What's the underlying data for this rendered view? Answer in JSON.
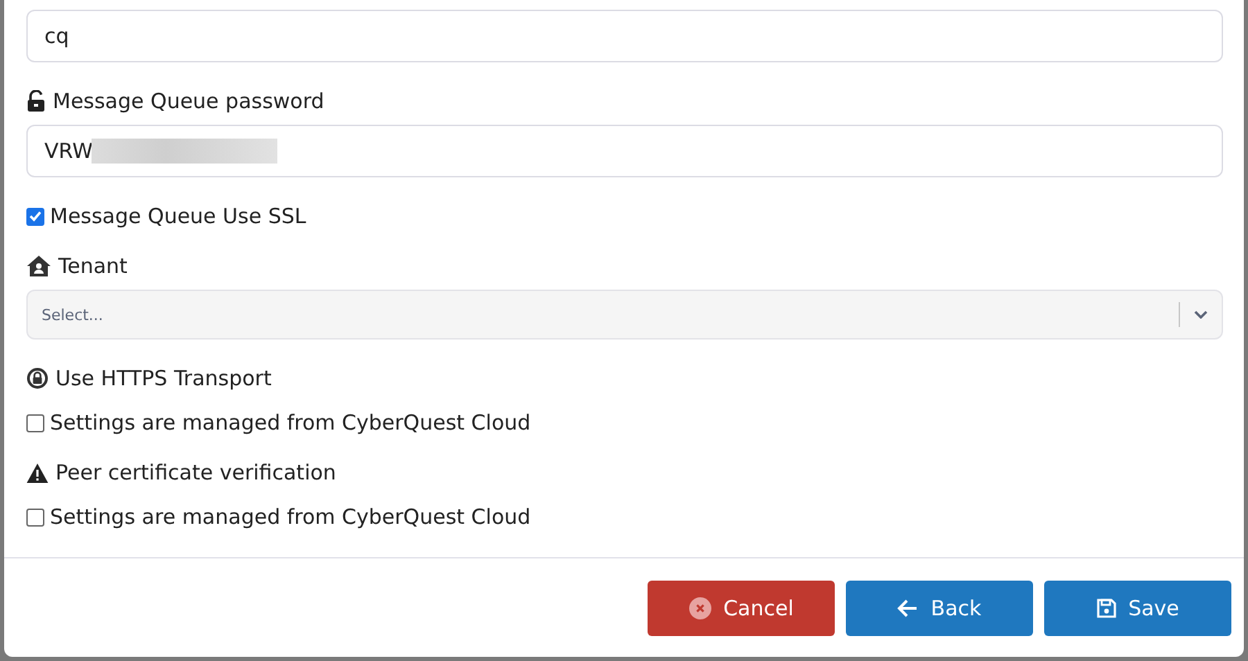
{
  "form": {
    "fields": [
      {
        "kind": "input",
        "value": "cq",
        "redacted": false
      },
      {
        "kind": "label",
        "text": "Message Queue password"
      },
      {
        "kind": "input",
        "value": "VRW",
        "redacted": true
      },
      {
        "kind": "checkbox",
        "label": "Message Queue Use SSL",
        "checked": true
      },
      {
        "kind": "label",
        "text": "Tenant"
      },
      {
        "kind": "select",
        "placeholder": "Select..."
      },
      {
        "kind": "label",
        "text": "Use HTTPS Transport"
      },
      {
        "kind": "checkbox",
        "label": "Settings are managed from CyberQuest Cloud",
        "checked": false
      },
      {
        "kind": "label",
        "text": "Peer certificate verification"
      },
      {
        "kind": "checkbox",
        "label": "Settings are managed from CyberQuest Cloud",
        "checked": false
      }
    ]
  },
  "buttons": [
    {
      "kind": "cancel",
      "label": "Cancel"
    },
    {
      "kind": "back",
      "label": "Back"
    },
    {
      "kind": "save",
      "label": "Save"
    }
  ]
}
